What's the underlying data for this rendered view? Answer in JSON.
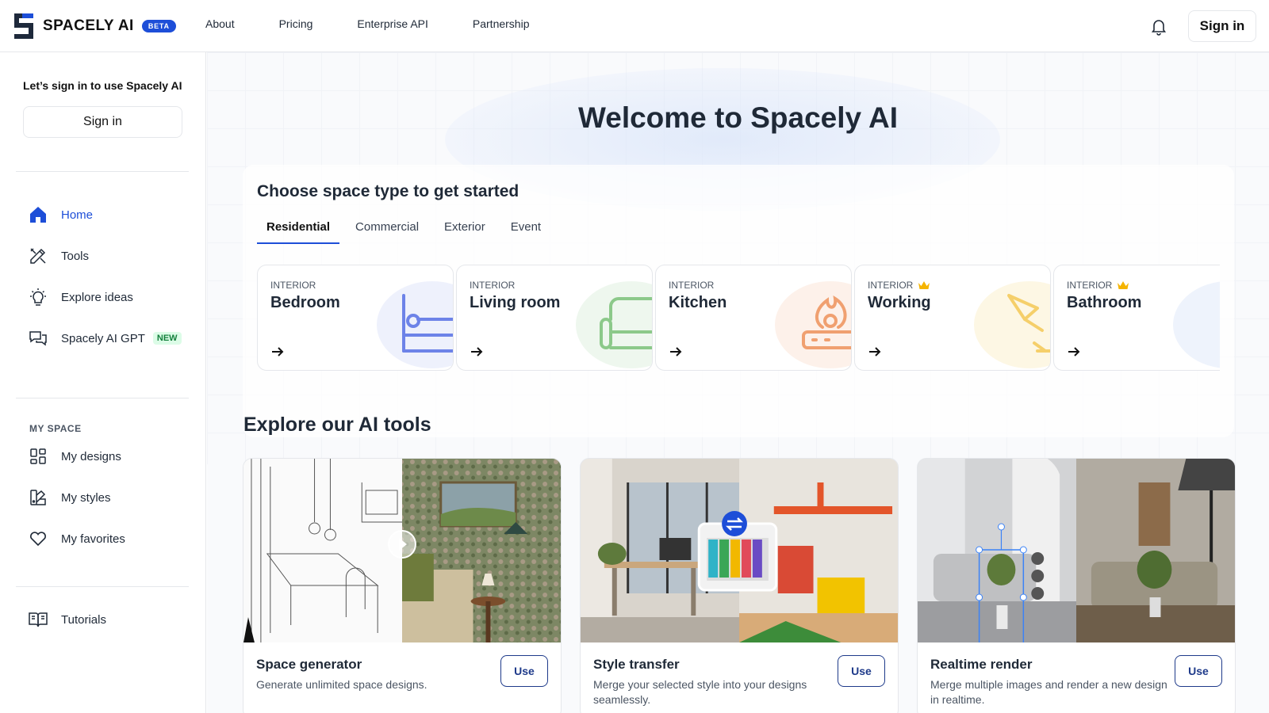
{
  "brand": {
    "name": "SPACELY AI",
    "badge": "BETA"
  },
  "nav": {
    "items": [
      "About",
      "Pricing",
      "Enterprise API",
      "Partnership"
    ]
  },
  "header": {
    "signin_label": "Sign in",
    "bell_icon": "bell-icon"
  },
  "sidebar": {
    "prompt": "Let’s sign in to use Spacely AI",
    "signin_label": "Sign in",
    "items": [
      {
        "label": "Home",
        "icon": "home-icon",
        "active": true
      },
      {
        "label": "Tools",
        "icon": "tools-icon"
      },
      {
        "label": "Explore ideas",
        "icon": "lightbulb-icon"
      },
      {
        "label": "Spacely AI GPT",
        "icon": "chat-bubbles-icon",
        "badge": "NEW"
      }
    ],
    "section_title": "MY SPACE",
    "my_space": [
      {
        "label": "My designs",
        "icon": "grid-icon"
      },
      {
        "label": "My styles",
        "icon": "palette-icon"
      },
      {
        "label": "My favorites",
        "icon": "heart-icon"
      }
    ],
    "tutorials": {
      "label": "Tutorials",
      "icon": "book-icon"
    }
  },
  "main": {
    "welcome": "Welcome to Spacely AI",
    "choose_title": "Choose space type to get started",
    "tabs": [
      {
        "label": "Residential",
        "active": true
      },
      {
        "label": "Commercial"
      },
      {
        "label": "Exterior"
      },
      {
        "label": "Event"
      }
    ],
    "rooms": [
      {
        "kind": "INTERIOR",
        "name": "Bedroom",
        "premium": false,
        "icon": "bed-icon",
        "color": "#6d83e8"
      },
      {
        "kind": "INTERIOR",
        "name": "Living room",
        "premium": false,
        "icon": "sofa-icon",
        "color": "#8cc98a"
      },
      {
        "kind": "INTERIOR",
        "name": "Kitchen",
        "premium": false,
        "icon": "stove-icon",
        "color": "#f0a070"
      },
      {
        "kind": "INTERIOR",
        "name": "Working",
        "premium": true,
        "icon": "desk-lamp-icon",
        "color": "#f5cf6a"
      },
      {
        "kind": "INTERIOR",
        "name": "Bathroom",
        "premium": true,
        "icon": "bath-icon",
        "color": "#8fb3f0"
      }
    ],
    "explore_title": "Explore our AI tools",
    "tools": [
      {
        "title": "Space generator",
        "desc": "Generate unlimited space designs.",
        "button": "Use"
      },
      {
        "title": "Style transfer",
        "desc": "Merge your selected style into your designs seamlessly.",
        "button": "Use"
      },
      {
        "title": "Realtime render",
        "desc": "Merge multiple images and render a new design in realtime.",
        "button": "Use"
      }
    ]
  },
  "colors": {
    "accent": "#1d4ed8",
    "badge_new_bg": "#dcfce7",
    "badge_new_text": "#15803d",
    "crown": "#f5b400"
  }
}
